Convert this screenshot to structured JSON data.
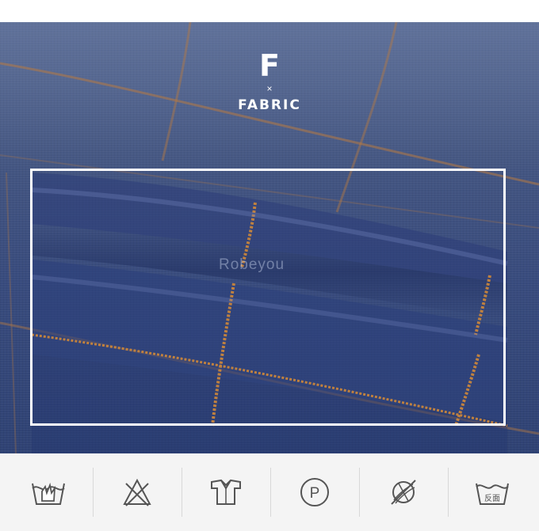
{
  "heading": {
    "letter": "F",
    "cross": "×",
    "word": "FABRIC"
  },
  "watermark": "Robeyou",
  "care_icons": [
    {
      "icon": "hand-wash-icon"
    },
    {
      "icon": "do-not-bleach-icon"
    },
    {
      "icon": "shirt-iron-icon"
    },
    {
      "icon": "dry-clean-p-icon",
      "letter": "P"
    },
    {
      "icon": "do-not-tumble-dry-icon"
    },
    {
      "icon": "wash-inside-out-icon",
      "label": "反面"
    }
  ],
  "colors": {
    "fabric": "#34477a",
    "check_stripe": "#b67a43",
    "frame": "#ffffff",
    "care_bar": "#f4f4f4",
    "icon_stroke": "#555555"
  }
}
